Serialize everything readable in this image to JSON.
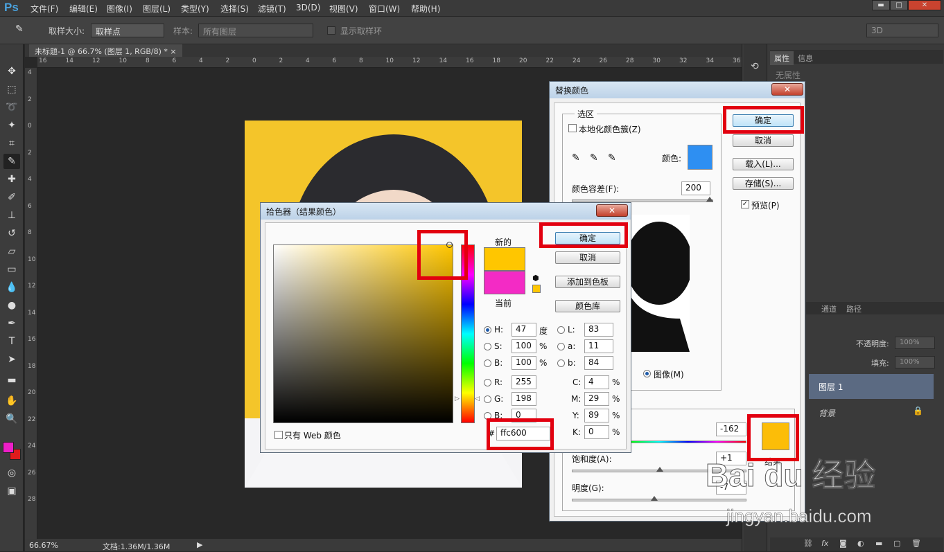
{
  "menubar": {
    "logo": "Ps",
    "items": [
      "文件(F)",
      "编辑(E)",
      "图像(I)",
      "图层(L)",
      "类型(Y)",
      "选择(S)",
      "滤镜(T)",
      "3D(D)",
      "视图(V)",
      "窗口(W)",
      "帮助(H)"
    ],
    "min": "▬",
    "max": "□",
    "close": "✕"
  },
  "options": {
    "sample_size_label": "取样大小:",
    "sample_size_value": "取样点",
    "sample_label": "样本:",
    "sample_value": "所有图层",
    "show_ring_label": "显示取样环",
    "workspace": "3D"
  },
  "document": {
    "tab_title": "未标题-1 @ 66.7% (图层 1, RGB/8) *",
    "tab_close": "×"
  },
  "ruler_h": [
    "16",
    "14",
    "12",
    "10",
    "8",
    "6",
    "4",
    "2",
    "0",
    "2",
    "4",
    "6",
    "8",
    "10",
    "12",
    "14",
    "16",
    "18",
    "20",
    "22",
    "24",
    "26",
    "28",
    "30",
    "32",
    "34",
    "36"
  ],
  "ruler_v": [
    "4",
    "2",
    "0",
    "2",
    "4",
    "6",
    "8",
    "10",
    "12",
    "14",
    "16",
    "18",
    "20",
    "22",
    "24",
    "26",
    "28"
  ],
  "status": {
    "zoom": "66.67%",
    "doc": "文档:1.36M/1.36M"
  },
  "right_panel": {
    "tab_properties": "属性",
    "tab_info": "信息",
    "no_properties": "无属性",
    "tab_channels": "通道",
    "tab_paths": "路径",
    "opacity_label": "不透明度:",
    "opacity_value": "100%",
    "fill_label": "填充:",
    "fill_value": "100%",
    "layer1": "图层 1",
    "background": "背景"
  },
  "replace_color": {
    "title": "替换颜色",
    "close": "✕",
    "selection_group": "选区",
    "localized_label": "本地化颜色簇(Z)",
    "color_label": "颜色:",
    "fuzziness_label": "颜色容差(F):",
    "fuzziness_value": "200",
    "image_radio": "图像(M)",
    "ok": "确定",
    "cancel": "取消",
    "load": "载入(L)...",
    "save": "存储(S)...",
    "preview": "预览(P)",
    "hue_value": "-162",
    "saturation_label": "饱和度(A):",
    "saturation_value": "+1",
    "lightness_label": "明度(G):",
    "lightness_value": "-7",
    "result_label": "结果",
    "sample_color": "#2e8ff2",
    "result_color": "#fcbd08"
  },
  "color_picker": {
    "title": "拾色器（结果颜色）",
    "close": "✕",
    "new_label": "新的",
    "current_label": "当前",
    "new_color": "#ffc600",
    "current_color": "#f32bc5",
    "ok": "确定",
    "cancel": "取消",
    "add_swatch": "添加到色板",
    "color_libraries": "颜色库",
    "H_label": "H:",
    "H": "47",
    "H_unit": "度",
    "S_label": "S:",
    "S": "100",
    "S_unit": "%",
    "B_label": "B:",
    "B": "100",
    "B_unit": "%",
    "R_label": "R:",
    "R": "255",
    "G_label": "G:",
    "G": "198",
    "Bl_label": "B:",
    "Bl": "0",
    "L_label": "L:",
    "L": "83",
    "a_label": "a:",
    "a": "11",
    "b_label": "b:",
    "b": "84",
    "C_label": "C:",
    "C": "4",
    "M_label": "M:",
    "M": "29",
    "Y_label": "Y:",
    "Y": "89",
    "K_label": "K:",
    "K": "0",
    "pct": "%",
    "hex_prefix": "#",
    "hex": "ffc600",
    "web_only": "只有 Web 颜色"
  },
  "watermark": {
    "brand": "Bai du 经验",
    "url": "jingyan.baidu.com"
  },
  "colors": {
    "foreground": "#ee1ec8",
    "background": "#e01b1b",
    "highlight": "#e2000f"
  }
}
